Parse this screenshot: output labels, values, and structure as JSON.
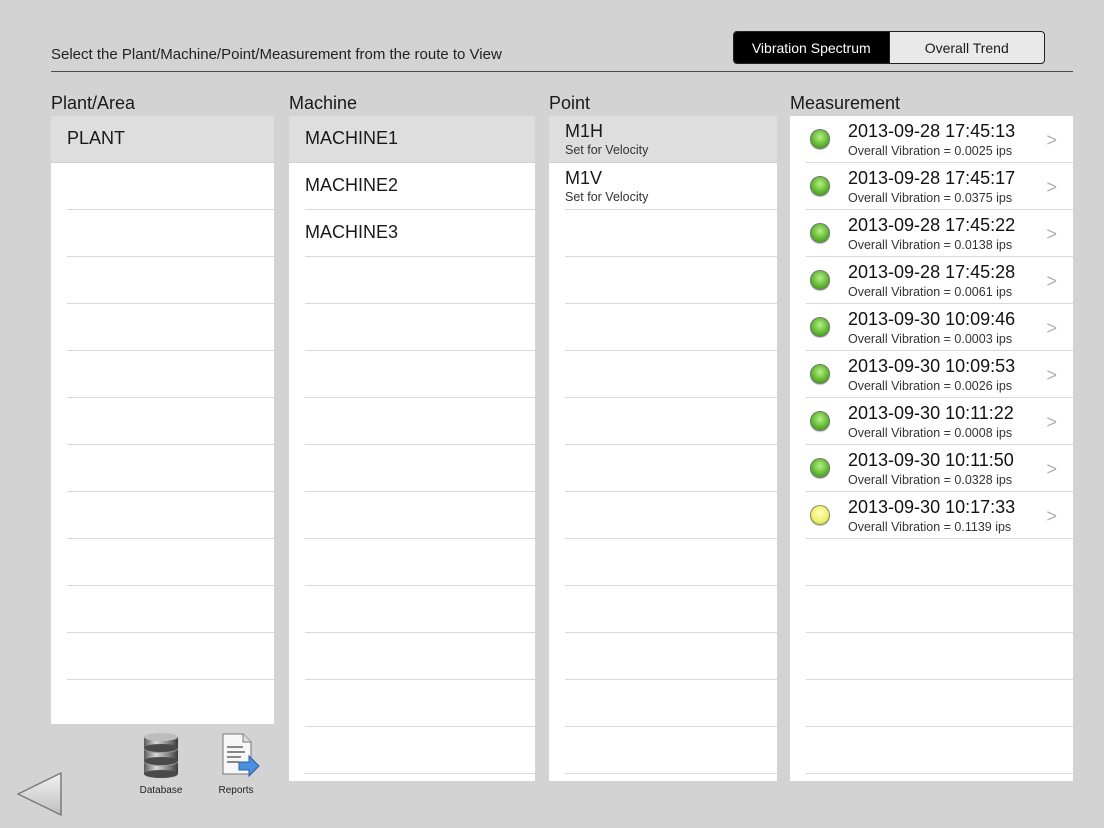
{
  "header": {
    "instruction": "Select the Plant/Machine/Point/Measurement from the route to View",
    "tabs": [
      {
        "label": "Vibration Spectrum",
        "active": true
      },
      {
        "label": "Overall Trend",
        "active": false
      }
    ]
  },
  "columns": {
    "plant": {
      "title": "Plant/Area",
      "items": [
        "PLANT"
      ]
    },
    "machine": {
      "title": "Machine",
      "items": [
        "MACHINE1",
        "MACHINE2",
        "MACHINE3"
      ]
    },
    "point": {
      "title": "Point",
      "items": [
        {
          "name": "M1H",
          "sub": "Set for Velocity"
        },
        {
          "name": "M1V",
          "sub": "Set for Velocity"
        }
      ]
    },
    "measurement": {
      "title": "Measurement",
      "items": [
        {
          "date": "2013-09-28 17:45:13",
          "value": "Overall Vibration = 0.0025 ips",
          "status": "green"
        },
        {
          "date": "2013-09-28 17:45:17",
          "value": "Overall Vibration = 0.0375 ips",
          "status": "green"
        },
        {
          "date": "2013-09-28 17:45:22",
          "value": "Overall Vibration = 0.0138 ips",
          "status": "green"
        },
        {
          "date": "2013-09-28 17:45:28",
          "value": "Overall Vibration = 0.0061 ips",
          "status": "green"
        },
        {
          "date": "2013-09-30 10:09:46",
          "value": "Overall Vibration = 0.0003 ips",
          "status": "green"
        },
        {
          "date": "2013-09-30 10:09:53",
          "value": "Overall Vibration = 0.0026 ips",
          "status": "green"
        },
        {
          "date": "2013-09-30 10:11:22",
          "value": "Overall Vibration = 0.0008 ips",
          "status": "green"
        },
        {
          "date": "2013-09-30 10:11:50",
          "value": "Overall Vibration = 0.0328 ips",
          "status": "green"
        },
        {
          "date": "2013-09-30 10:17:33",
          "value": "Overall Vibration = 0.1139 ips",
          "status": "yellow"
        }
      ]
    }
  },
  "toolbar": {
    "database_label": "Database",
    "reports_label": "Reports",
    "back_icon": "back-triangle-icon",
    "database_icon": "database-icon",
    "reports_icon": "reports-icon"
  },
  "colors": {
    "background": "#d3d3d3",
    "selected_row": "#dedede",
    "status_green": "#5bb52a",
    "status_yellow": "#eef06a",
    "segment_active": "#000000"
  }
}
